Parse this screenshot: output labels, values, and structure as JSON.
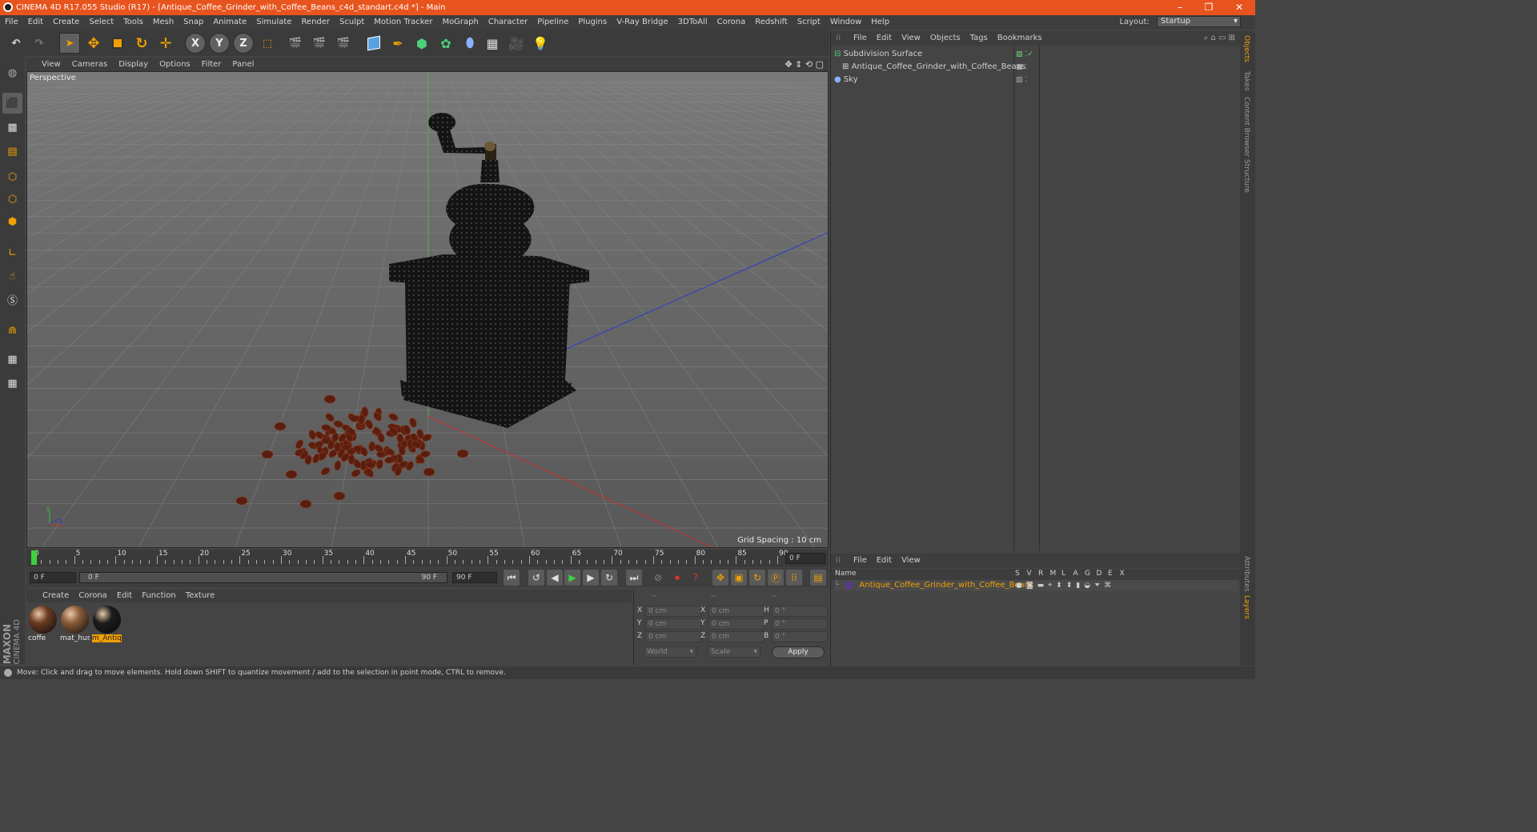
{
  "window": {
    "title": "CINEMA 4D R17.055 Studio (R17) - [Antique_Coffee_Grinder_with_Coffee_Beans_c4d_standart.c4d *] - Main",
    "minimize": "–",
    "restore": "❐",
    "close": "✕"
  },
  "menubar": {
    "items": [
      "File",
      "Edit",
      "Create",
      "Select",
      "Tools",
      "Mesh",
      "Snap",
      "Animate",
      "Simulate",
      "Render",
      "Sculpt",
      "Motion Tracker",
      "MoGraph",
      "Character",
      "Pipeline",
      "Plugins",
      "V-Ray Bridge",
      "3DToAll",
      "Corona",
      "Redshift",
      "Script",
      "Window",
      "Help"
    ],
    "layout_label": "Layout:",
    "layout_value": "Startup"
  },
  "toolbar": {
    "axis_x": "X",
    "axis_y": "Y",
    "axis_z": "Z"
  },
  "viewport": {
    "menu": [
      "View",
      "Cameras",
      "Display",
      "Options",
      "Filter",
      "Panel"
    ],
    "label": "Perspective",
    "grid_spacing": "Grid Spacing : 10 cm"
  },
  "timeline": {
    "ticks": [
      "0",
      "5",
      "10",
      "15",
      "20",
      "25",
      "30",
      "35",
      "40",
      "45",
      "50",
      "55",
      "60",
      "65",
      "70",
      "75",
      "80",
      "85",
      "90"
    ],
    "current_frame": "0 F",
    "start": "0 F",
    "range_start": "0 F",
    "range_end": "90 F",
    "end": "90 F"
  },
  "material_manager": {
    "menu": [
      "Create",
      "Corona",
      "Edit",
      "Function",
      "Texture"
    ],
    "materials": [
      {
        "name": "coffe",
        "color": "#6b3a22"
      },
      {
        "name": "mat_hus",
        "color": "#8a5a38"
      },
      {
        "name": "m_Antiq",
        "color": "#1c1c1c"
      }
    ]
  },
  "coordinates": {
    "header": [
      "--",
      "--",
      "--"
    ],
    "rows": [
      {
        "a": "X",
        "av": "0 cm",
        "b": "X",
        "bv": "0 cm",
        "c": "H",
        "cv": "0 °"
      },
      {
        "a": "Y",
        "av": "0 cm",
        "b": "Y",
        "bv": "0 cm",
        "c": "P",
        "cv": "0 °"
      },
      {
        "a": "Z",
        "av": "0 cm",
        "b": "Z",
        "bv": "0 cm",
        "c": "B",
        "cv": "0 °"
      }
    ],
    "mode": "World",
    "scale": "Scale",
    "apply": "Apply"
  },
  "object_manager": {
    "menu": [
      "File",
      "Edit",
      "View",
      "Objects",
      "Tags",
      "Bookmarks"
    ],
    "objects": [
      {
        "name": "Subdivision Surface"
      },
      {
        "name": "Antique_Coffee_Grinder_with_Coffee_Beans"
      },
      {
        "name": "Sky"
      }
    ]
  },
  "layer_manager": {
    "menu": [
      "File",
      "Edit",
      "View"
    ],
    "columns": [
      "Name",
      "S",
      "V",
      "R",
      "M",
      "L",
      "A",
      "G",
      "D",
      "E",
      "X"
    ],
    "layer": "Antique_Coffee_Grinder_with_Coffee_Beans"
  },
  "side_tabs": [
    "Objects",
    "Takes",
    "Content Browser",
    "Structure"
  ],
  "side_tabs_bottom": [
    "Attributes",
    "Layers"
  ],
  "status": "Move: Click and drag to move elements. Hold down SHIFT to quantize movement / add to the selection in point mode, CTRL to remove.",
  "brand": {
    "maxon": "MAXON",
    "c4d": "CINEMA 4D"
  },
  "colors": {
    "accent": "#e8541d",
    "highlight": "#f0a000"
  }
}
